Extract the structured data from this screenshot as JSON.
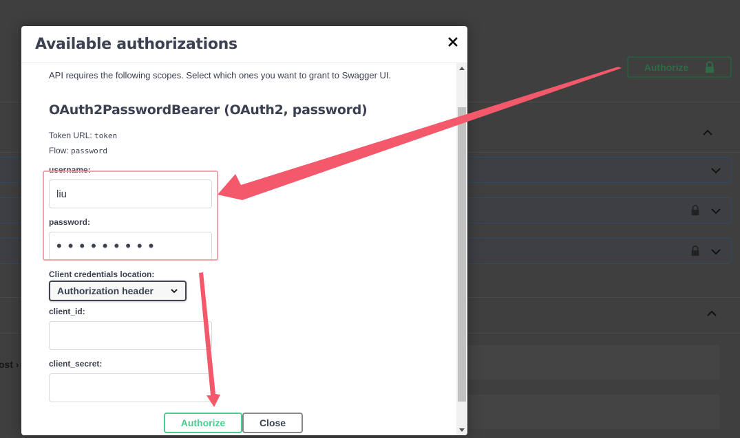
{
  "background": {
    "authorize_label": "Authorize",
    "side_text": "ost ›"
  },
  "modal": {
    "title": "Available authorizations",
    "scope_text": "API requires the following scopes. Select which ones you want to grant to Swagger UI.",
    "scheme_title": "OAuth2PasswordBearer (OAuth2, password)",
    "token_url_label": "Token URL:",
    "token_url_value": "token",
    "flow_label": "Flow:",
    "flow_value": "password",
    "username_label": "username:",
    "username_value": "liu",
    "password_label": "password:",
    "password_value": "•••••••••",
    "client_location_label": "Client credentials location:",
    "client_location_value": "Authorization header",
    "client_id_label": "client_id:",
    "client_id_value": "",
    "client_secret_label": "client_secret:",
    "client_secret_value": "",
    "authorize_button": "Authorize",
    "close_button": "Close"
  },
  "colors": {
    "accent_green": "#49cc90",
    "annotation_red": "#f4586b",
    "text": "#3b4151"
  }
}
